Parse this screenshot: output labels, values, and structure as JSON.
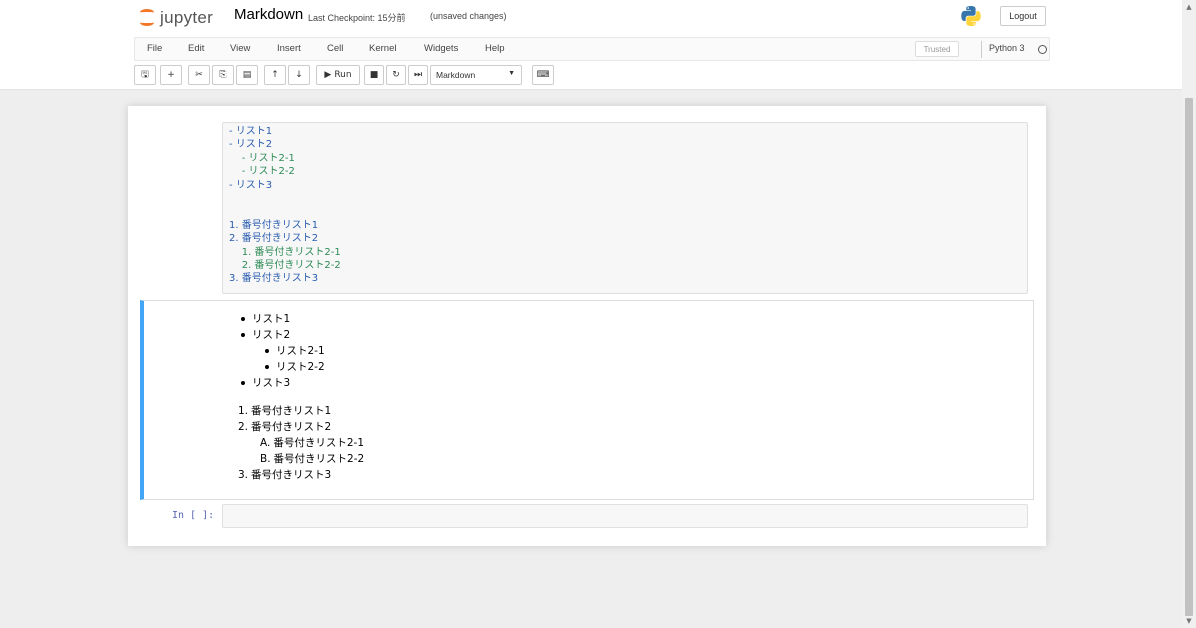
{
  "header": {
    "logo_text": "jupyter",
    "notebook_name": "Markdown",
    "checkpoint": "Last Checkpoint: 15分前",
    "unsaved": "(unsaved changes)",
    "logout_label": "Logout"
  },
  "menubar": {
    "items": [
      "File",
      "Edit",
      "View",
      "Insert",
      "Cell",
      "Kernel",
      "Widgets",
      "Help"
    ],
    "trusted_label": "Trusted",
    "kernel_name": "Python 3"
  },
  "toolbar": {
    "buttons": [
      {
        "name": "save-button",
        "icon": "save-icon",
        "glyph": "🖫"
      },
      {
        "name": "insert-cell-button",
        "icon": "plus-icon",
        "glyph": "+"
      },
      {
        "name": "cut-button",
        "icon": "scissors-icon",
        "glyph": "✂"
      },
      {
        "name": "copy-button",
        "icon": "copy-icon",
        "glyph": "⎘"
      },
      {
        "name": "paste-button",
        "icon": "paste-icon",
        "glyph": "▤"
      },
      {
        "name": "move-up-button",
        "icon": "arrow-up-icon",
        "glyph": "↑"
      },
      {
        "name": "move-down-button",
        "icon": "arrow-down-icon",
        "glyph": "↓"
      }
    ],
    "run_label": "Run",
    "celltype_value": "Markdown"
  },
  "cells": {
    "source_lines": [
      {
        "text": "- リスト1",
        "level": 0
      },
      {
        "text": "- リスト2",
        "level": 0
      },
      {
        "text": "    - リスト2-1",
        "level": 1
      },
      {
        "text": "    - リスト2-2",
        "level": 1
      },
      {
        "text": "- リスト3",
        "level": 0
      },
      {
        "text": "",
        "level": -1
      },
      {
        "text": "",
        "level": -1
      },
      {
        "text": "1. 番号付きリスト1",
        "level": 0
      },
      {
        "text": "2. 番号付きリスト2",
        "level": 0
      },
      {
        "text": "    1. 番号付きリスト2-1",
        "level": 1
      },
      {
        "text": "    2. 番号付きリスト2-2",
        "level": 1
      },
      {
        "text": "3. 番号付きリスト3",
        "level": 0
      }
    ],
    "rendered_ul": [
      {
        "text": "リスト1",
        "nested": false
      },
      {
        "text": "リスト2",
        "nested": false
      },
      {
        "text": "リスト2-1",
        "nested": true
      },
      {
        "text": "リスト2-2",
        "nested": true
      },
      {
        "text": "リスト3",
        "nested": false
      }
    ],
    "rendered_ol": [
      {
        "marker": "1.",
        "text": "番号付きリスト1",
        "nested": false
      },
      {
        "marker": "2.",
        "text": "番号付きリスト2",
        "nested": false
      },
      {
        "marker": "A.",
        "text": "番号付きリスト2-1",
        "nested": true
      },
      {
        "marker": "B.",
        "text": "番号付きリスト2-2",
        "nested": true
      },
      {
        "marker": "3.",
        "text": "番号付きリスト3",
        "nested": false
      }
    ],
    "empty_prompt": "In [ ]:"
  }
}
